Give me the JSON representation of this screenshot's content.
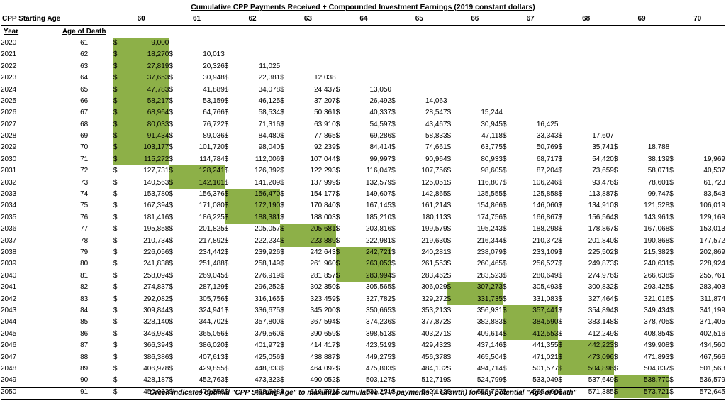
{
  "title": "Cumulative CPP Payments Received + Compounded Investment Earnings (2019 constant dollars)",
  "starting_age_label": "CPP Starting Age",
  "year_label": "Year",
  "age_of_death_label": "Age of Death",
  "currency_symbol": "$",
  "starting_ages": [
    "60",
    "61",
    "62",
    "63",
    "64",
    "65",
    "66",
    "67",
    "68",
    "69",
    "70"
  ],
  "highlight_color": "#8db048",
  "rows": [
    {
      "year": "2020",
      "age": "61",
      "values": [
        "9,000",
        "",
        "",
        "",
        "",
        "",
        "",
        "",
        "",
        "",
        ""
      ],
      "best": 0
    },
    {
      "year": "2021",
      "age": "62",
      "values": [
        "18,270",
        "10,013",
        "",
        "",
        "",
        "",
        "",
        "",
        "",
        "",
        ""
      ],
      "best": 0
    },
    {
      "year": "2022",
      "age": "63",
      "values": [
        "27,819",
        "20,326",
        "11,025",
        "",
        "",
        "",
        "",
        "",
        "",
        "",
        ""
      ],
      "best": 0
    },
    {
      "year": "2023",
      "age": "64",
      "values": [
        "37,653",
        "30,948",
        "22,381",
        "12,038",
        "",
        "",
        "",
        "",
        "",
        "",
        ""
      ],
      "best": 0
    },
    {
      "year": "2024",
      "age": "65",
      "values": [
        "47,783",
        "41,889",
        "34,078",
        "24,437",
        "13,050",
        "",
        "",
        "",
        "",
        "",
        ""
      ],
      "best": 0
    },
    {
      "year": "2025",
      "age": "66",
      "values": [
        "58,217",
        "53,159",
        "46,125",
        "37,207",
        "26,492",
        "14,063",
        "",
        "",
        "",
        "",
        ""
      ],
      "best": 0
    },
    {
      "year": "2026",
      "age": "67",
      "values": [
        "68,964",
        "64,766",
        "58,534",
        "50,361",
        "40,337",
        "28,547",
        "15,244",
        "",
        "",
        "",
        ""
      ],
      "best": 0
    },
    {
      "year": "2027",
      "age": "68",
      "values": [
        "80,033",
        "76,722",
        "71,316",
        "63,910",
        "54,597",
        "43,467",
        "30,945",
        "16,425",
        "",
        "",
        ""
      ],
      "best": 0
    },
    {
      "year": "2028",
      "age": "69",
      "values": [
        "91,434",
        "89,036",
        "84,480",
        "77,865",
        "69,286",
        "58,833",
        "47,118",
        "33,343",
        "17,607",
        "",
        ""
      ],
      "best": 0
    },
    {
      "year": "2029",
      "age": "70",
      "values": [
        "103,177",
        "101,720",
        "98,040",
        "92,239",
        "84,414",
        "74,661",
        "63,775",
        "50,769",
        "35,741",
        "18,788",
        ""
      ],
      "best": 0
    },
    {
      "year": "2030",
      "age": "71",
      "values": [
        "115,272",
        "114,784",
        "112,006",
        "107,044",
        "99,997",
        "90,964",
        "80,933",
        "68,717",
        "54,420",
        "38,139",
        "19,969"
      ],
      "best": 0
    },
    {
      "year": "2031",
      "age": "72",
      "values": [
        "127,731",
        "128,241",
        "126,392",
        "122,293",
        "116,047",
        "107,756",
        "98,605",
        "87,204",
        "73,659",
        "58,071",
        "40,537"
      ],
      "best": 1
    },
    {
      "year": "2032",
      "age": "73",
      "values": [
        "140,563",
        "142,101",
        "141,209",
        "137,999",
        "132,579",
        "125,051",
        "116,807",
        "106,246",
        "93,476",
        "78,601",
        "61,723"
      ],
      "best": 1
    },
    {
      "year": "2033",
      "age": "74",
      "values": [
        "153,780",
        "156,376",
        "156,470",
        "154,177",
        "149,607",
        "142,865",
        "135,555",
        "125,858",
        "113,887",
        "99,747",
        "83,543"
      ],
      "best": 2
    },
    {
      "year": "2034",
      "age": "75",
      "values": [
        "167,394",
        "171,080",
        "172,190",
        "170,840",
        "167,145",
        "161,214",
        "154,866",
        "146,060",
        "134,910",
        "121,528",
        "106,019"
      ],
      "best": 2
    },
    {
      "year": "2035",
      "age": "76",
      "values": [
        "181,416",
        "186,225",
        "188,381",
        "188,003",
        "185,210",
        "180,113",
        "174,756",
        "166,867",
        "156,564",
        "143,961",
        "129,169"
      ],
      "best": 2
    },
    {
      "year": "2036",
      "age": "77",
      "values": [
        "195,858",
        "201,825",
        "205,057",
        "205,681",
        "203,816",
        "199,579",
        "195,243",
        "188,298",
        "178,867",
        "167,068",
        "153,013"
      ],
      "best": 3
    },
    {
      "year": "2037",
      "age": "78",
      "values": [
        "210,734",
        "217,892",
        "222,234",
        "223,889",
        "222,981",
        "219,630",
        "216,344",
        "210,372",
        "201,840",
        "190,868",
        "177,572"
      ],
      "best": 3
    },
    {
      "year": "2038",
      "age": "79",
      "values": [
        "226,056",
        "234,442",
        "239,926",
        "242,643",
        "242,721",
        "240,281",
        "238,079",
        "233,109",
        "225,502",
        "215,382",
        "202,869"
      ],
      "best": 4
    },
    {
      "year": "2039",
      "age": "80",
      "values": [
        "241,838",
        "251,488",
        "258,149",
        "261,960",
        "263,053",
        "261,553",
        "260,465",
        "256,527",
        "249,873",
        "240,631",
        "228,924"
      ],
      "best": 4
    },
    {
      "year": "2040",
      "age": "81",
      "values": [
        "258,094",
        "269,045",
        "276,919",
        "281,857",
        "283,994",
        "283,462",
        "283,523",
        "280,649",
        "274,976",
        "266,638",
        "255,761"
      ],
      "best": 4
    },
    {
      "year": "2041",
      "age": "82",
      "values": [
        "274,837",
        "287,129",
        "296,252",
        "302,350",
        "305,565",
        "306,029",
        "307,273",
        "305,493",
        "300,832",
        "293,425",
        "283,403"
      ],
      "best": 6
    },
    {
      "year": "2042",
      "age": "83",
      "values": [
        "292,082",
        "305,756",
        "316,165",
        "323,459",
        "327,782",
        "329,272",
        "331,735",
        "331,083",
        "327,464",
        "321,016",
        "311,874"
      ],
      "best": 6
    },
    {
      "year": "2043",
      "age": "84",
      "values": [
        "309,844",
        "324,941",
        "336,675",
        "345,200",
        "350,665",
        "353,213",
        "356,931",
        "357,441",
        "354,894",
        "349,434",
        "341,199"
      ],
      "best": 7
    },
    {
      "year": "2044",
      "age": "85",
      "values": [
        "328,140",
        "344,702",
        "357,800",
        "367,594",
        "374,236",
        "377,872",
        "382,883",
        "384,590",
        "383,148",
        "378,705",
        "371,405"
      ],
      "best": 7
    },
    {
      "year": "2045",
      "age": "86",
      "values": [
        "346,984",
        "365,056",
        "379,560",
        "390,659",
        "398,513",
        "403,271",
        "409,614",
        "412,553",
        "412,249",
        "408,854",
        "402,516"
      ],
      "best": 7
    },
    {
      "year": "2046",
      "age": "87",
      "values": [
        "366,394",
        "386,020",
        "401,972",
        "414,417",
        "423,519",
        "429,432",
        "437,146",
        "441,355",
        "442,223",
        "439,908",
        "434,560"
      ],
      "best": 8
    },
    {
      "year": "2047",
      "age": "88",
      "values": [
        "386,386",
        "407,613",
        "425,056",
        "438,887",
        "449,275",
        "456,378",
        "465,504",
        "471,021",
        "473,096",
        "471,893",
        "467,566"
      ],
      "best": 8
    },
    {
      "year": "2048",
      "age": "89",
      "values": [
        "406,978",
        "429,855",
        "448,833",
        "464,092",
        "475,803",
        "484,132",
        "494,714",
        "501,577",
        "504,896",
        "504,837",
        "501,563"
      ],
      "best": 8
    },
    {
      "year": "2049",
      "age": "90",
      "values": [
        "428,187",
        "452,763",
        "473,323",
        "490,052",
        "503,127",
        "512,719",
        "524,799",
        "533,049",
        "537,649",
        "538,770",
        "536,579"
      ],
      "best": 9
    },
    {
      "year": "2050",
      "age": "91",
      "values": [
        "450,033",
        "476,358",
        "498,548",
        "516,791",
        "531,271",
        "542,163",
        "555,787",
        "565,466",
        "571,385",
        "573,721",
        "572,645"
      ],
      "best": 9
    }
  ],
  "footer": "Green indicates optimal \"CPP Starting Age\" to maximize cumulative CPP payments (+ Growth) for any potential \"Age of Death\""
}
